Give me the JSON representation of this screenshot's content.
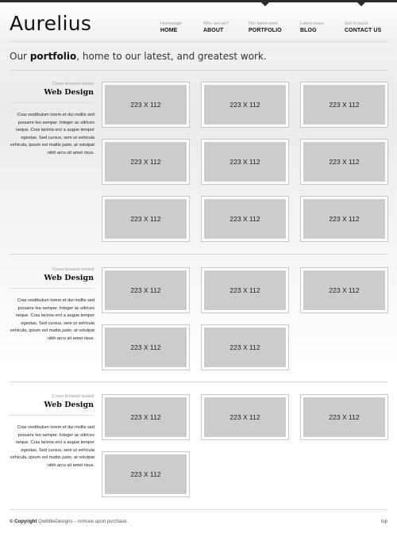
{
  "site": {
    "logo": "Aurelius"
  },
  "nav": [
    {
      "sub": "Homepage",
      "label": "HOME",
      "active": false
    },
    {
      "sub": "Who are we?",
      "label": "ABOUT",
      "active": false
    },
    {
      "sub": "Our latest work",
      "label": "PORTFOLIO",
      "active": true
    },
    {
      "sub": "Latest news",
      "label": "BLOG",
      "active": false
    },
    {
      "sub": "Get in touch",
      "label": "CONTACT US",
      "active": true
    }
  ],
  "intro": {
    "pre": "Our ",
    "bold": "portfolio",
    "post": ", home to our latest, and greatest work."
  },
  "sections": [
    {
      "subtitle": "Cross-browser tested",
      "title": "Web Design",
      "text": "Cras vestibulum lorem et dui mollis sed posuere leo semper. Integer ac ultrices neque. Cras lacinia orci a augue tempor egestas. Sed cursus, sem ut vehicula vehicula, ipsum est mattis justo, at volutpat nibh arcu sit amet risus.",
      "thumbs": [
        "223 X 112",
        "223 X 112",
        "223 X 112",
        "223 X 112",
        "223 X 112",
        "223 X 112",
        "223 X 112",
        "223 X 112",
        "223 X 112"
      ]
    },
    {
      "subtitle": "Cross-browser tested",
      "title": "Web Design",
      "text": "Cras vestibulum lorem et dui mollis sed posuere leo semper. Integer ac ultrices neque. Cras lacinia orci a augue tempor egestas. Sed cursus, sem ut vehicula vehicula, ipsum est mattis justo, at volutpat nibh arcu sit amet risus.",
      "thumbs": [
        "223 X 112",
        "223 X 112",
        "223 X 112",
        "223 X 112",
        "223 X 112"
      ]
    },
    {
      "subtitle": "Cross-browser tested",
      "title": "Web Design",
      "text": "Cras vestibulum lorem et dui mollis sed posuere leo semper. Integer ac ultrices neque. Cras lacinia orci a augue tempor egestas. Sed cursus, sem ut vehicula vehicula, ipsum est mattis justo, at volutpat nibh arcu sit amet risus.",
      "thumbs": [
        "223 X 112",
        "223 X 112",
        "223 X 112",
        "223 X 112"
      ]
    }
  ],
  "footer": {
    "copyright_label": "© Copyright",
    "copyright_text": " QwibbleDesigns – remove upon purchase.",
    "top_link": "top"
  },
  "colors": {
    "topbar": "#2b2b2b",
    "thumb_fill": "#cccccc",
    "divider": "#d6d6d6"
  }
}
